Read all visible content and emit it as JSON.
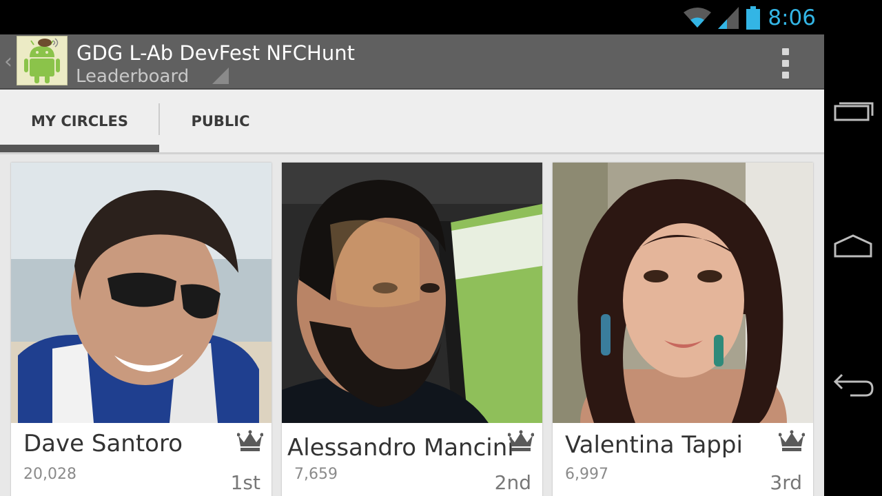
{
  "status_bar": {
    "time": "8:06",
    "icons": [
      "wifi-icon",
      "signal-icon",
      "battery-icon"
    ],
    "accent": "#33b5e5"
  },
  "action_bar": {
    "title": "GDG L-Ab DevFest NFCHunt",
    "subtitle": "Leaderboard",
    "icons": [
      "up-caret-icon",
      "android-app-icon",
      "spinner-triangle-icon",
      "overflow-menu-icon"
    ]
  },
  "tabs": [
    {
      "label": "MY CIRCLES",
      "selected": true
    },
    {
      "label": "PUBLIC",
      "selected": false
    }
  ],
  "leaderboard": [
    {
      "name": "Dave Santoro",
      "points": "20,028",
      "rank": "1st",
      "icon": "crown-icon"
    },
    {
      "name": "Alessandro Mancini",
      "points": "7,659",
      "rank": "2nd",
      "icon": "crown-icon"
    },
    {
      "name": "Valentina Tappi",
      "points": "6,997",
      "rank": "3rd",
      "icon": "crown-icon"
    }
  ],
  "nav_bar": {
    "icons": [
      "recent-apps-icon",
      "home-icon",
      "back-icon"
    ]
  }
}
